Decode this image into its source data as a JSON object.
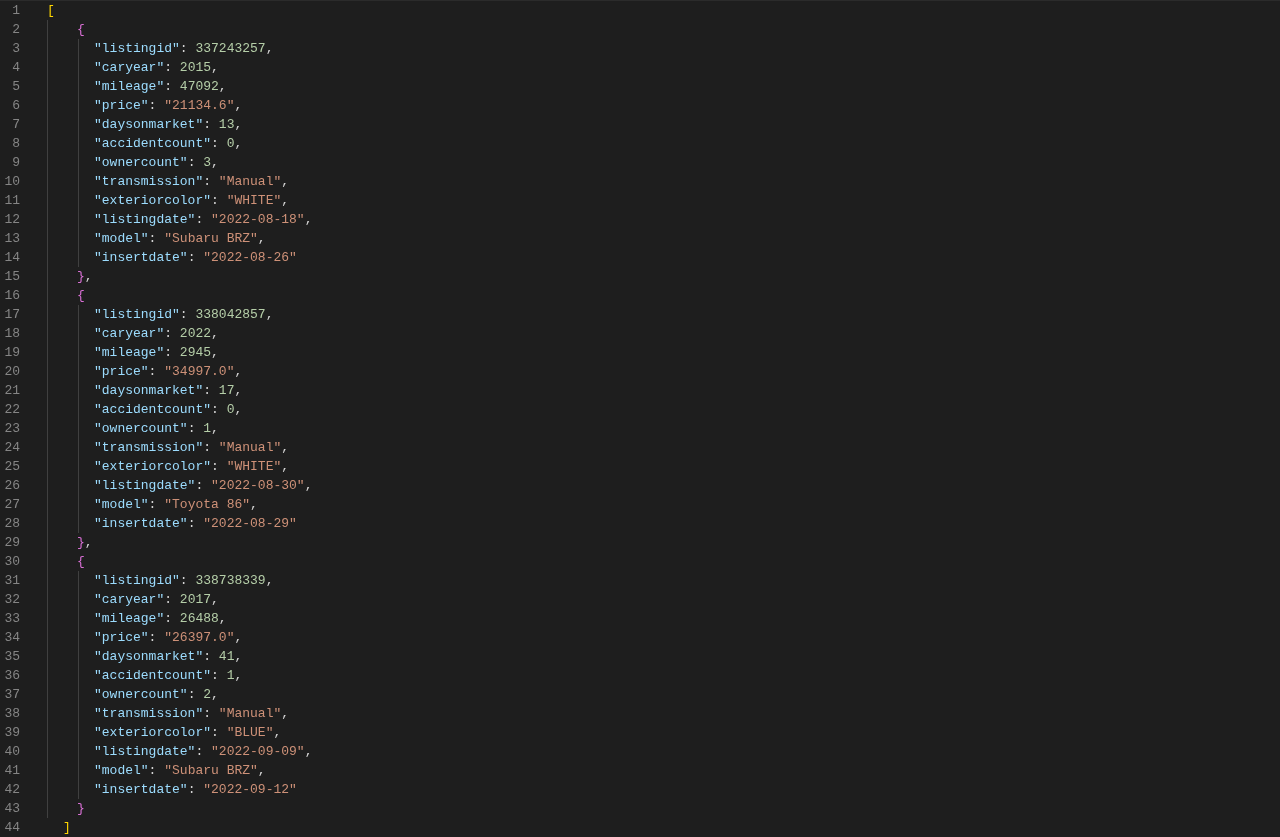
{
  "editor": {
    "line_numbers": [
      "1",
      "2",
      "3",
      "4",
      "5",
      "6",
      "7",
      "8",
      "9",
      "10",
      "11",
      "12",
      "13",
      "14",
      "15",
      "16",
      "17",
      "18",
      "19",
      "20",
      "21",
      "22",
      "23",
      "24",
      "25",
      "26",
      "27",
      "28",
      "29",
      "30",
      "31",
      "32",
      "33",
      "34",
      "35",
      "36",
      "37",
      "38",
      "39",
      "40",
      "41",
      "42",
      "43",
      "44"
    ],
    "open": "[",
    "objects": [
      {
        "open": "{",
        "close": "}",
        "comma": ",",
        "entries": [
          {
            "key": "\"listingid\"",
            "colon": ":",
            "value": "337243257",
            "kind": "number",
            "comma": ","
          },
          {
            "key": "\"caryear\"",
            "colon": ":",
            "value": "2015",
            "kind": "number",
            "comma": ","
          },
          {
            "key": "\"mileage\"",
            "colon": ":",
            "value": "47092",
            "kind": "number",
            "comma": ","
          },
          {
            "key": "\"price\"",
            "colon": ":",
            "value": "\"21134.6\"",
            "kind": "string",
            "comma": ","
          },
          {
            "key": "\"daysonmarket\"",
            "colon": ":",
            "value": "13",
            "kind": "number",
            "comma": ","
          },
          {
            "key": "\"accidentcount\"",
            "colon": ":",
            "value": "0",
            "kind": "number",
            "comma": ","
          },
          {
            "key": "\"ownercount\"",
            "colon": ":",
            "value": "3",
            "kind": "number",
            "comma": ","
          },
          {
            "key": "\"transmission\"",
            "colon": ":",
            "value": "\"Manual\"",
            "kind": "string",
            "comma": ","
          },
          {
            "key": "\"exteriorcolor\"",
            "colon": ":",
            "value": "\"WHITE\"",
            "kind": "string",
            "comma": ","
          },
          {
            "key": "\"listingdate\"",
            "colon": ":",
            "value": "\"2022-08-18\"",
            "kind": "string",
            "comma": ","
          },
          {
            "key": "\"model\"",
            "colon": ":",
            "value": "\"Subaru BRZ\"",
            "kind": "string",
            "comma": ","
          },
          {
            "key": "\"insertdate\"",
            "colon": ":",
            "value": "\"2022-08-26\"",
            "kind": "string"
          }
        ]
      },
      {
        "open": "{",
        "close": "}",
        "comma": ",",
        "entries": [
          {
            "key": "\"listingid\"",
            "colon": ":",
            "value": "338042857",
            "kind": "number",
            "comma": ","
          },
          {
            "key": "\"caryear\"",
            "colon": ":",
            "value": "2022",
            "kind": "number",
            "comma": ","
          },
          {
            "key": "\"mileage\"",
            "colon": ":",
            "value": "2945",
            "kind": "number",
            "comma": ","
          },
          {
            "key": "\"price\"",
            "colon": ":",
            "value": "\"34997.0\"",
            "kind": "string",
            "comma": ","
          },
          {
            "key": "\"daysonmarket\"",
            "colon": ":",
            "value": "17",
            "kind": "number",
            "comma": ","
          },
          {
            "key": "\"accidentcount\"",
            "colon": ":",
            "value": "0",
            "kind": "number",
            "comma": ","
          },
          {
            "key": "\"ownercount\"",
            "colon": ":",
            "value": "1",
            "kind": "number",
            "comma": ","
          },
          {
            "key": "\"transmission\"",
            "colon": ":",
            "value": "\"Manual\"",
            "kind": "string",
            "comma": ","
          },
          {
            "key": "\"exteriorcolor\"",
            "colon": ":",
            "value": "\"WHITE\"",
            "kind": "string",
            "comma": ","
          },
          {
            "key": "\"listingdate\"",
            "colon": ":",
            "value": "\"2022-08-30\"",
            "kind": "string",
            "comma": ","
          },
          {
            "key": "\"model\"",
            "colon": ":",
            "value": "\"Toyota 86\"",
            "kind": "string",
            "comma": ","
          },
          {
            "key": "\"insertdate\"",
            "colon": ":",
            "value": "\"2022-08-29\"",
            "kind": "string"
          }
        ]
      },
      {
        "open": "{",
        "close": "}",
        "entries": [
          {
            "key": "\"listingid\"",
            "colon": ":",
            "value": "338738339",
            "kind": "number",
            "comma": ","
          },
          {
            "key": "\"caryear\"",
            "colon": ":",
            "value": "2017",
            "kind": "number",
            "comma": ","
          },
          {
            "key": "\"mileage\"",
            "colon": ":",
            "value": "26488",
            "kind": "number",
            "comma": ","
          },
          {
            "key": "\"price\"",
            "colon": ":",
            "value": "\"26397.0\"",
            "kind": "string",
            "comma": ","
          },
          {
            "key": "\"daysonmarket\"",
            "colon": ":",
            "value": "41",
            "kind": "number",
            "comma": ","
          },
          {
            "key": "\"accidentcount\"",
            "colon": ":",
            "value": "1",
            "kind": "number",
            "comma": ","
          },
          {
            "key": "\"ownercount\"",
            "colon": ":",
            "value": "2",
            "kind": "number",
            "comma": ","
          },
          {
            "key": "\"transmission\"",
            "colon": ":",
            "value": "\"Manual\"",
            "kind": "string",
            "comma": ","
          },
          {
            "key": "\"exteriorcolor\"",
            "colon": ":",
            "value": "\"BLUE\"",
            "kind": "string",
            "comma": ","
          },
          {
            "key": "\"listingdate\"",
            "colon": ":",
            "value": "\"2022-09-09\"",
            "kind": "string",
            "comma": ","
          },
          {
            "key": "\"model\"",
            "colon": ":",
            "value": "\"Subaru BRZ\"",
            "kind": "string",
            "comma": ","
          },
          {
            "key": "\"insertdate\"",
            "colon": ":",
            "value": "\"2022-09-12\"",
            "kind": "string"
          }
        ]
      }
    ],
    "close": "]"
  }
}
